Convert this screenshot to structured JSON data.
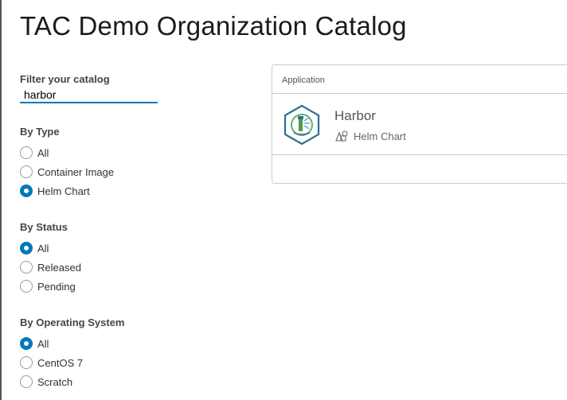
{
  "page": {
    "title": "TAC Demo Organization Catalog"
  },
  "filter": {
    "label": "Filter your catalog",
    "value": "harbor"
  },
  "by_type": {
    "title": "By Type",
    "options": [
      {
        "label": "All",
        "checked": false
      },
      {
        "label": "Container Image",
        "checked": false
      },
      {
        "label": "Helm Chart",
        "checked": true
      }
    ]
  },
  "by_status": {
    "title": "By Status",
    "options": [
      {
        "label": "All",
        "checked": true
      },
      {
        "label": "Released",
        "checked": false
      },
      {
        "label": "Pending",
        "checked": false
      }
    ]
  },
  "by_os": {
    "title": "By Operating System",
    "options": [
      {
        "label": "All",
        "checked": true
      },
      {
        "label": "CentOS 7",
        "checked": false
      },
      {
        "label": "Scratch",
        "checked": false
      }
    ]
  },
  "results": {
    "header": "Application",
    "items": [
      {
        "name": "Harbor",
        "type": "Helm Chart",
        "logo_icon": "harbor-logo-icon",
        "type_icon": "helm-chart-icon"
      }
    ]
  },
  "colors": {
    "accent": "#0079b8",
    "border": "#cccccc",
    "logo_green": "#4d9c4a",
    "logo_outline": "#2f6f8f"
  }
}
